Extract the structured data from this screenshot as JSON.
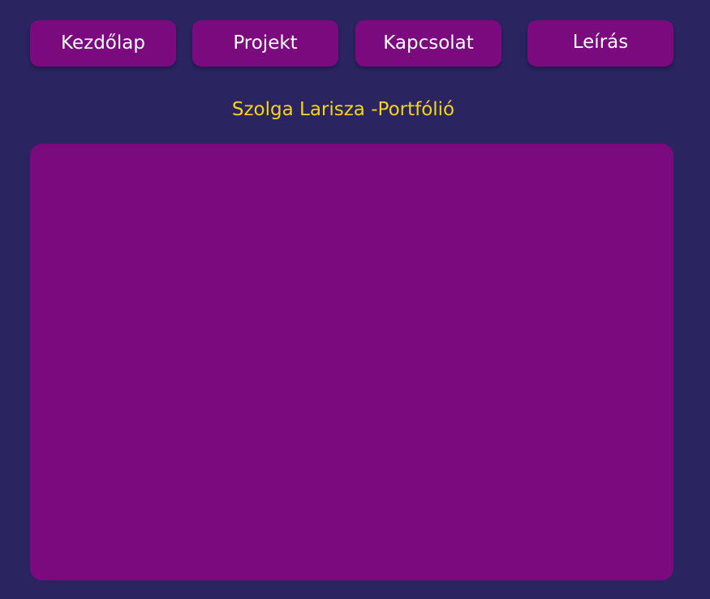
{
  "nav": {
    "items": [
      {
        "label": "Kezdőlap"
      },
      {
        "label": "Projekt"
      },
      {
        "label": "Kapcsolat"
      },
      {
        "label": "Leírás"
      }
    ]
  },
  "page": {
    "title": "Szolga Larisza -Portfólió"
  },
  "colors": {
    "background": "#2a2460",
    "accent": "#7b0a7e",
    "title_text": "#f5d31c",
    "button_text": "#ffffff"
  }
}
